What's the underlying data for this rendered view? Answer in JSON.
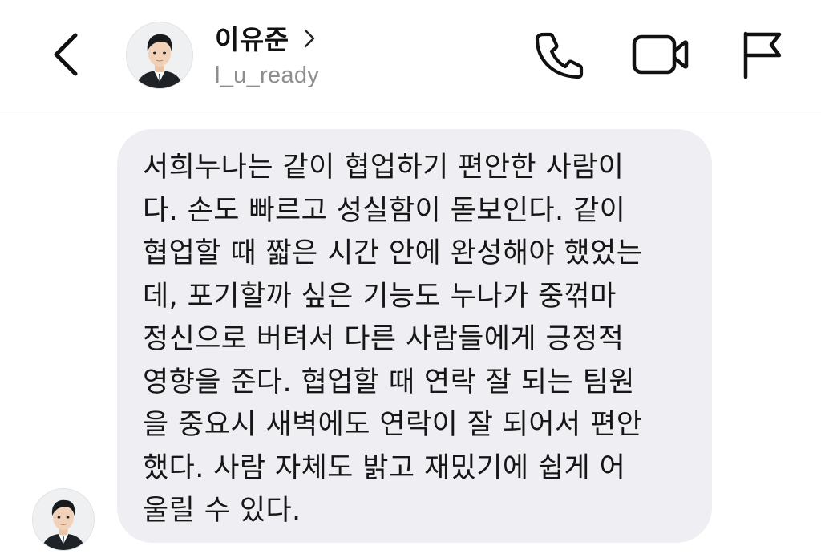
{
  "header": {
    "contact_name": "이유준",
    "username": "l_u_ready",
    "icons": {
      "back": "chevron-left-icon",
      "profile_chevron": "chevron-right-icon",
      "call": "phone-icon",
      "video": "video-camera-icon",
      "report": "flag-icon"
    }
  },
  "conversation": {
    "messages": [
      {
        "sender": "이유준",
        "lines": [
          "서희누나는 같이 협업하기 편안한 사람이",
          "다. 손도 빠르고 성실함이 돋보인다. 같이",
          "협업할 때 짧은 시간 안에 완성해야 했었는",
          "데, 포기할까 싶은 기능도 누나가 중꺾마",
          "정신으로 버텨서 다른 사람들에게 긍정적",
          "영향을 준다. 협업할 때 연락 잘 되는 팀원",
          "을 중요시 새벽에도 연락이 잘 되어서 편안",
          "했다. 사람 자체도 밝고 재밌기에 쉽게 어",
          "울릴 수 있다."
        ]
      }
    ]
  },
  "colors": {
    "bubble_bg": "#efeff3",
    "text": "#161616",
    "secondary_text": "#8e8e8e",
    "divider": "#ececec"
  }
}
